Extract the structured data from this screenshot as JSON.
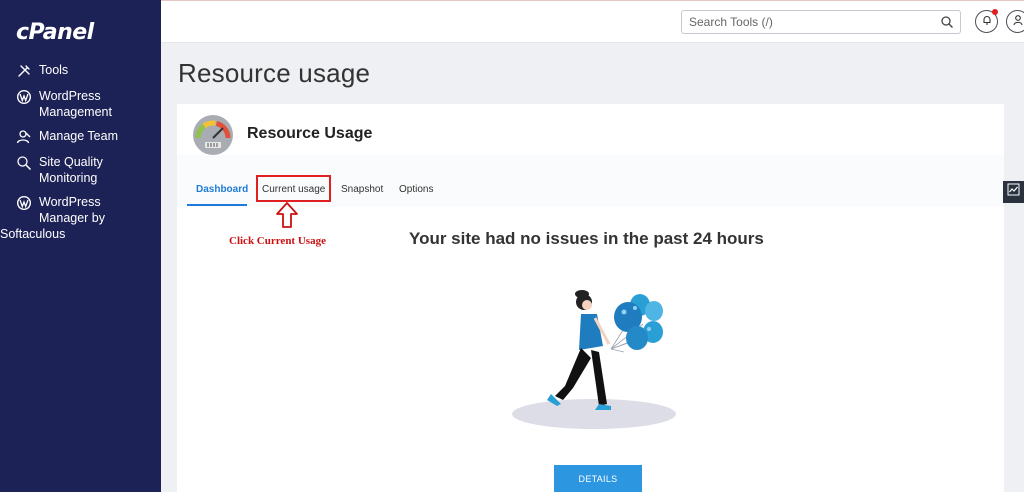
{
  "brand": {
    "logo_text": "cPanel"
  },
  "sidebar": {
    "items": [
      {
        "label": "Tools",
        "icon": "tools-icon"
      },
      {
        "label_line1": "WordPress",
        "label_line2": "Management",
        "icon": "wordpress-icon"
      },
      {
        "label": "Manage Team",
        "icon": "team-icon"
      },
      {
        "label_line1": "Site Quality",
        "label_line2": "Monitoring",
        "icon": "magnifier-icon"
      },
      {
        "label_line1": "WordPress",
        "label_line2": "Manager by",
        "label_line3": "Softaculous",
        "icon": "wordpress-icon"
      }
    ]
  },
  "topbar": {
    "search_placeholder": "Search Tools (/)",
    "notification_dot_color": "#e02020"
  },
  "main": {
    "page_title": "Resource usage",
    "card_title": "Resource Usage",
    "tabs": [
      {
        "label": "Dashboard",
        "active": true
      },
      {
        "label": "Current usage",
        "active": false
      },
      {
        "label": "Snapshot",
        "active": false
      },
      {
        "label": "Options",
        "active": false
      }
    ],
    "annotation": "Click Current Usage",
    "headline": "Your site had no issues in the past 24 hours",
    "details_button": "DETAILS"
  },
  "colors": {
    "sidebar_bg": "#1c2256",
    "accent": "#1f7ad8",
    "button": "#2c96e0",
    "annotation": "#cc1010"
  }
}
